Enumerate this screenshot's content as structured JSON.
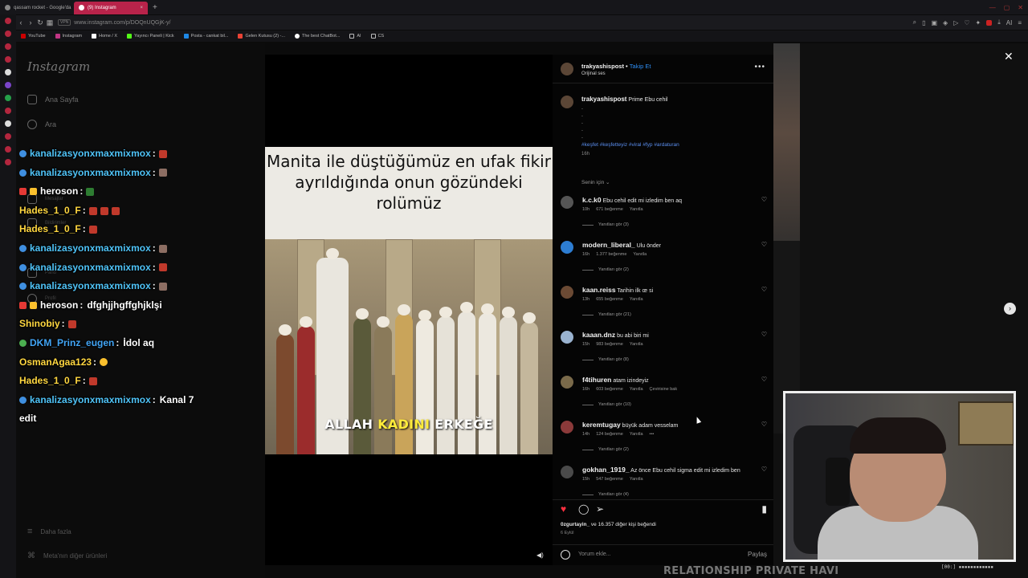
{
  "browser": {
    "tabs": [
      {
        "label": "qassam rocket - Google'da",
        "active": false
      },
      {
        "label": "(9) Instagram",
        "active": true
      }
    ],
    "url": "www.instagram.com/p/DOQnUQGjK-y/",
    "vpn_label": "VPN",
    "bookmarks": [
      "YouTube",
      "Instagram",
      "Home / X",
      "Yayıncı Paneli | Kick",
      "Posta - cankat bil...",
      "Gelen Kutusu (2) -...",
      "The best ChatBot...",
      "AI",
      "CS"
    ],
    "ai_label": "AI"
  },
  "instagram_nav": {
    "logo": "Instagram",
    "items": [
      "Ana Sayfa",
      "Ara",
      "Mesajlar",
      "Bildirimler",
      "Pano",
      "Profil"
    ],
    "more": "Daha fazla",
    "meta": "Meta'nın diğer ürünleri"
  },
  "chat": [
    {
      "user": "kanalizasyonxmaxmixmox",
      "sep": " :",
      "msg": "",
      "color": "cyan"
    },
    {
      "user": "kanalizasyonxmaxmixmox",
      "sep": " :",
      "msg": "",
      "color": "cyan"
    },
    {
      "user": "heroson",
      "sep": " :",
      "msg": "",
      "color": "white"
    },
    {
      "user": "Hades_1_0_F",
      "sep": " :",
      "msg": "",
      "color": "gold"
    },
    {
      "user": "Hades_1_0_F",
      "sep": " :",
      "msg": "",
      "color": "gold"
    },
    {
      "user": "kanalizasyonxmaxmixmox",
      "sep": " :",
      "msg": "",
      "color": "cyan"
    },
    {
      "user": "kanalizasyonxmaxmixmox",
      "sep": " :",
      "msg": "",
      "color": "cyan"
    },
    {
      "user": "kanalizasyonxmaxmixmox",
      "sep": " :",
      "msg": "",
      "color": "cyan"
    },
    {
      "user": "heroson",
      "sep": " :",
      "msg": "dfghjjhgffghjklşi",
      "color": "white"
    },
    {
      "user": "Shinobiy",
      "sep": " :",
      "msg": "",
      "color": "gold"
    },
    {
      "user": "DKM_Prinz_eugen",
      "sep": " :",
      "msg": "İdol aq",
      "color": "blue"
    },
    {
      "user": "OsmanAgaa123",
      "sep": " :",
      "msg": "",
      "color": "gold"
    },
    {
      "user": "Hades_1_0_F",
      "sep": " :",
      "msg": "",
      "color": "gold"
    },
    {
      "user": "kanalizasyonxmaxmixmox",
      "sep": " :",
      "msg": "Kanal 7",
      "color": "cyan"
    },
    {
      "user": "",
      "sep": "",
      "msg": "edit",
      "color": "white"
    }
  ],
  "video": {
    "caption_top_line1": "Manita ile düştüğümüz en ufak fikir",
    "caption_top_line2": "ayrıldığında onun gözündeki rolümüz",
    "caption_bottom_a": "ALLAH ",
    "caption_bottom_b": "KADINI",
    "caption_bottom_c": " ERKEĞE"
  },
  "post": {
    "author": "trakyashispost",
    "dot": "•",
    "follow": "Takip Et",
    "audio": "Orijinal ses",
    "caption_user": "trakyashispost",
    "caption_text": "Prime Ebu cehil",
    "caption_dots": [
      ".",
      ".",
      ".",
      ".",
      "."
    ],
    "hashtags": "#keşfet #keşfetteyiz #viral #fyp #ardaturan",
    "caption_time": "16h",
    "sort_label": "Senin için ⌄",
    "comments": [
      {
        "user": "k.c.k0",
        "text": "Ebu cehil edit mi izledim ben aq",
        "time": "10h",
        "likes": "671 beğenme",
        "reply": "Yanıtla",
        "extra": "",
        "replies": "Yanıtları gör (3)"
      },
      {
        "user": "modern_liberal_",
        "text": "Ulu önder",
        "time": "16h",
        "likes": "1.377 beğenme",
        "reply": "Yanıtla",
        "extra": "",
        "replies": "Yanıtları gör (2)"
      },
      {
        "user": "kaan.reiss",
        "text": "Tarihin ilk œ si",
        "time": "13h",
        "likes": "655 beğenme",
        "reply": "Yanıtla",
        "extra": "",
        "replies": "Yanıtları gör (21)"
      },
      {
        "user": "kaaan.dnz",
        "text": "bu abi biri mi",
        "time": "15h",
        "likes": "983 beğenme",
        "reply": "Yanıtla",
        "extra": "",
        "replies": "Yanıtları gör (8)"
      },
      {
        "user": "f4tihuren",
        "text": "atam izindeyiz",
        "time": "16h",
        "likes": "603 beğenme",
        "reply": "Yanıtla",
        "extra": "Çevirisine bak",
        "replies": "Yanıtları gör (10)"
      },
      {
        "user": "keremtugay",
        "text": "büyük adam vesselam",
        "time": "14h",
        "likes": "124 beğenme",
        "reply": "Yanıtla",
        "extra": "•••",
        "replies": "Yanıtları gör (2)"
      },
      {
        "user": "gokhan_1919_",
        "text": "Az önce Ebu cehil sigma edit mi izledim ben",
        "time": "15h",
        "likes": "547 beğenme",
        "reply": "Yanıtla",
        "extra": "",
        "replies": "Yanıtları gör (4)"
      }
    ],
    "likes_user": "0zgurtayin_",
    "likes_text": " ve 16.357 diğer kişi beğendi",
    "date": "6 Eylül",
    "add_comment_placeholder": "Yorum ekle...",
    "post_button": "Paylaş"
  },
  "stream_overlay": {
    "bottom_tag": "RELATIONSHIP PRIVATE HAVI",
    "status": "[00:] ▪▪▪▪▪▪▪▪▪▪▪▪"
  }
}
